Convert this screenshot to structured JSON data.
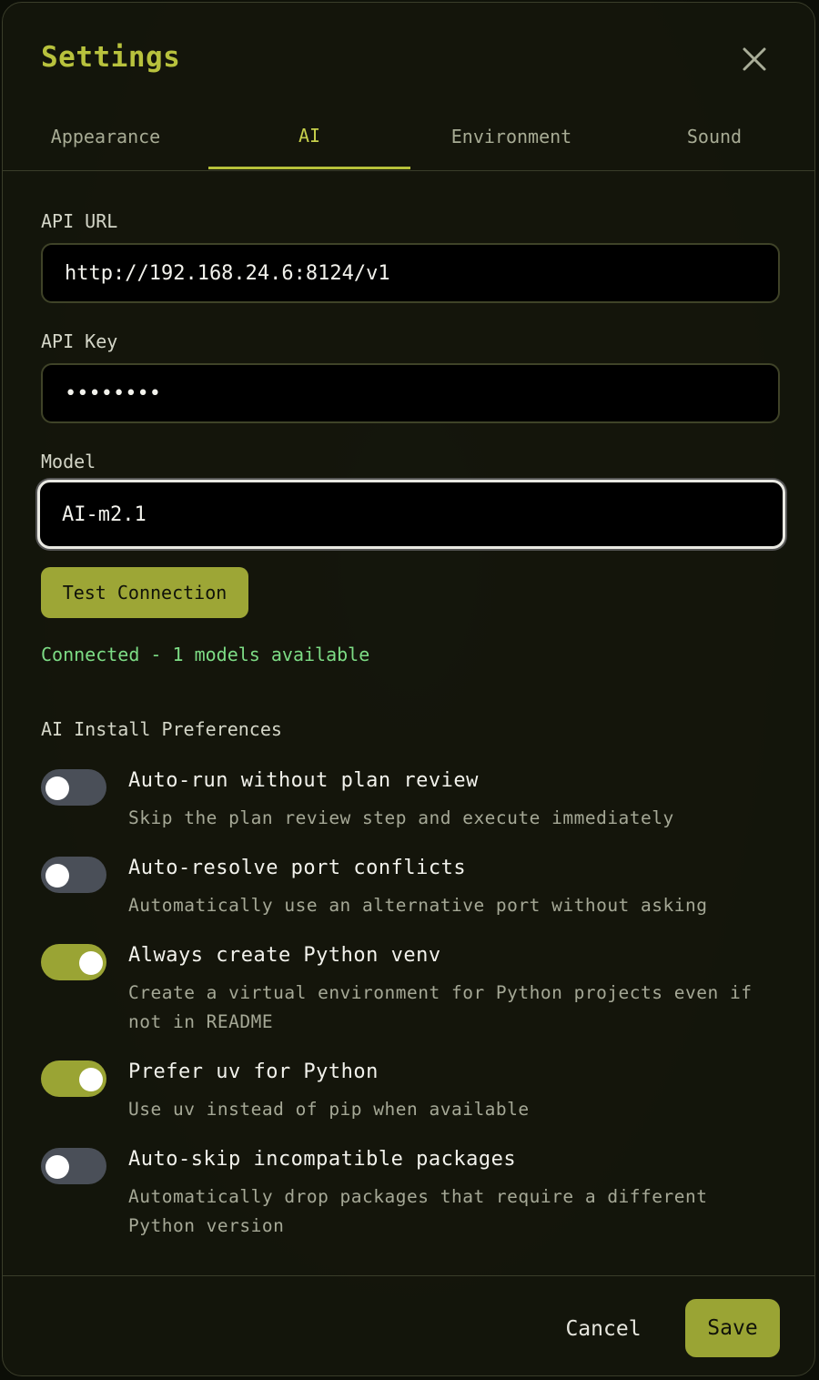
{
  "dialog": {
    "title": "Settings",
    "close_icon": "close-icon"
  },
  "tabs": [
    {
      "label": "Appearance",
      "active": false
    },
    {
      "label": "AI",
      "active": true
    },
    {
      "label": "Environment",
      "active": false
    },
    {
      "label": "Sound",
      "active": false
    }
  ],
  "ai": {
    "api_url": {
      "label": "API URL",
      "value": "http://192.168.24.6:8124/v1"
    },
    "api_key": {
      "label": "API Key",
      "value": "••••••••"
    },
    "model": {
      "label": "Model",
      "value": "AI-m2.1"
    },
    "test_button": "Test Connection",
    "status": "Connected - 1 models available",
    "install_prefs": {
      "title": "AI Install Preferences",
      "items": [
        {
          "title": "Auto-run without plan review",
          "description": "Skip the plan review step and execute immediately",
          "enabled": false
        },
        {
          "title": "Auto-resolve port conflicts",
          "description": "Automatically use an alternative port without asking",
          "enabled": false
        },
        {
          "title": "Always create Python venv",
          "description": "Create a virtual environment for Python projects even if not in README",
          "enabled": true
        },
        {
          "title": "Prefer uv for Python",
          "description": "Use uv instead of pip when available",
          "enabled": true
        },
        {
          "title": "Auto-skip incompatible packages",
          "description": "Automatically drop packages that require a different Python version",
          "enabled": false
        }
      ]
    }
  },
  "footer": {
    "cancel_label": "Cancel",
    "save_label": "Save"
  },
  "colors": {
    "accent": "#b6c13a",
    "status_ok": "#7ddc85"
  }
}
